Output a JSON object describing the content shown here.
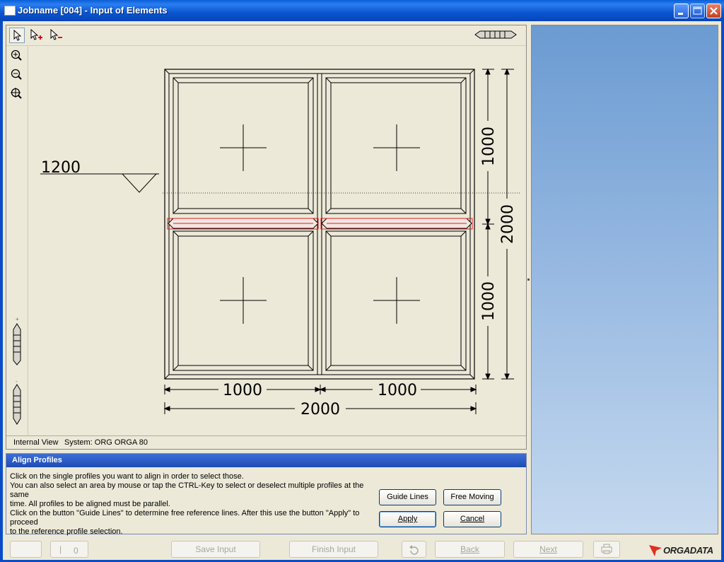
{
  "window": {
    "title": "Jobname [004] - Input of Elements"
  },
  "drawing": {
    "height_marker": "1200",
    "dim_col_left": "1000",
    "dim_col_right": "1000",
    "dim_total_width": "2000",
    "dim_row_top": "1000",
    "dim_row_bottom": "1000",
    "dim_total_height": "2000",
    "selection_color": "#e02020"
  },
  "status": {
    "view": "Internal View",
    "system": "System: ORG ORGA 80"
  },
  "align_panel": {
    "title": "Align Profiles",
    "lines": [
      "Click on the single profiles you want to align in order to select those.",
      "You can also select an area by mouse or tap the CTRL-Key to select or deselect multiple profiles at the same",
      "time. All profiles to be aligned must be parallel.",
      "Click on the button \"Guide Lines\" to determine free reference lines. After this use the button \"Apply\" to proceed",
      "to the reference profile selection."
    ],
    "guide_lines_label": "Guide Lines",
    "free_moving_label": "Free Moving",
    "apply_label": "Apply",
    "cancel_label": "Cancel"
  },
  "bottom": {
    "counter": "0",
    "save_input": "Save Input",
    "finish_input": "Finish Input",
    "back": "Back",
    "next": "Next",
    "logo_text": "ORGADATA"
  },
  "colors": {
    "titlebar": "#0a5fd8",
    "logo_red": "#e03020",
    "right_panel_top": "#6b9bd2"
  }
}
